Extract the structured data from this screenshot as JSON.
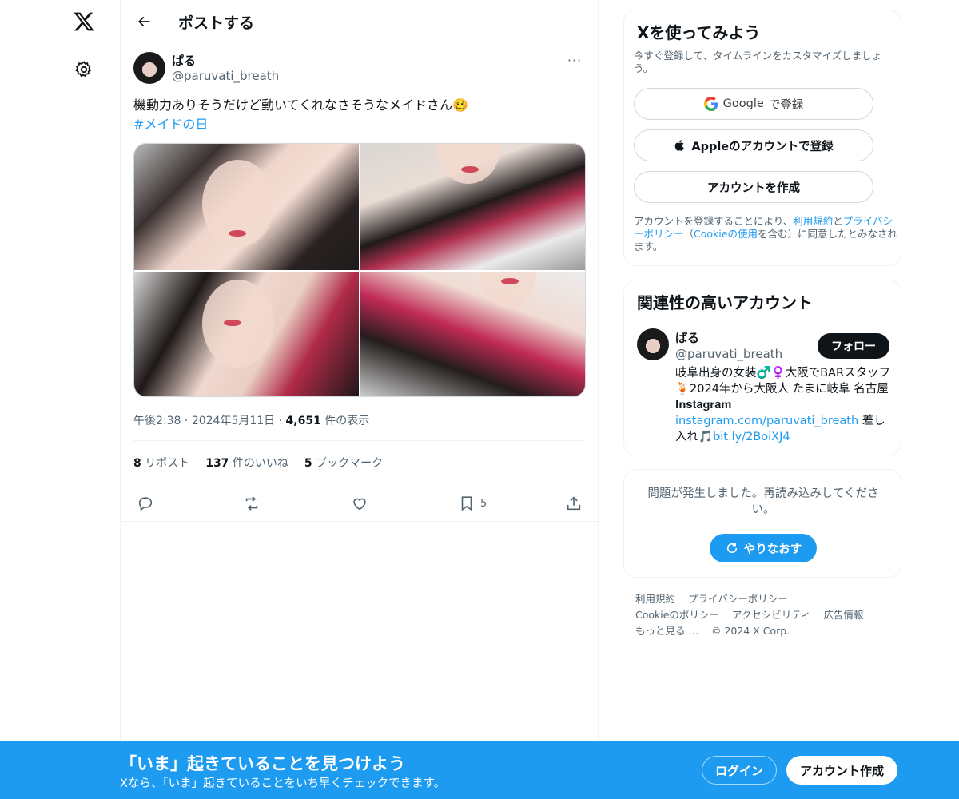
{
  "nav": {
    "logo_icon": "x-logo-icon",
    "settings_icon": "gear-icon"
  },
  "header": {
    "title": "ポストする"
  },
  "tweet": {
    "author_name": "ぱる",
    "author_handle": "@paruvati_breath",
    "more": "···",
    "text": "機動力ありそうだけど動いてくれなさそうなメイドさん🥴",
    "hashtag": "#メイドの日",
    "time": "午後2:38",
    "date": "2024年5月11日",
    "views_count": "4,651",
    "views_label": "件の表示",
    "reposts_count": "8",
    "reposts_label": "リポスト",
    "likes_count": "137",
    "likes_label": "件のいいね",
    "bookmarks_count": "5",
    "bookmarks_label": "ブックマーク",
    "bookmark_action_count": "5"
  },
  "signup_card": {
    "title": "Xを使ってみよう",
    "subtitle": "今すぐ登録して、タイムラインをカスタマイズしましょう。",
    "google_brand": "Google",
    "google_label": "で登録",
    "apple_label": "Appleのアカウントで登録",
    "create_label": "アカウントを作成",
    "legal_1": "アカウントを登録することにより、",
    "legal_terms": "利用規約",
    "legal_2": "と",
    "legal_privacy": "プライバシーポリシー",
    "legal_3": "（",
    "legal_cookie": "Cookieの使用",
    "legal_4": "を含む）に同意したとみなされます。"
  },
  "related": {
    "title": "関連性の高いアカウント",
    "name": "ぱる",
    "handle": "@paruvati_breath",
    "follow_label": "フォロー",
    "bio_1": "岐阜出身の女装♂️♀️大阪でBARスタッフ🍹2024年から大阪人 たまに岐阜 名古屋 𝐈𝐧𝐬𝐭𝐚𝐠𝐫𝐚𝐦 ",
    "bio_link": "instagram.com/paruvati_breath",
    "bio_2": " 差し入れ🎵",
    "bio_link2": "bit.ly/2BoiXJ4"
  },
  "error_card": {
    "message": "問題が発生しました。再読み込みしてください。",
    "retry_label": "やりなおす"
  },
  "footer": {
    "links": [
      "利用規約",
      "プライバシーポリシー",
      "Cookieのポリシー",
      "アクセシビリティ",
      "広告情報",
      "もっと見る …"
    ],
    "copyright": "© 2024 X Corp."
  },
  "banner": {
    "title": "「いま」起きていることを見つけよう",
    "subtitle": "Xなら、「いま」起きていることをいち早くチェックできます。",
    "login_label": "ログイン",
    "signup_label": "アカウント作成"
  },
  "colors": {
    "accent": "#1d9bf0",
    "text": "#0f1419",
    "muted": "#536471"
  }
}
